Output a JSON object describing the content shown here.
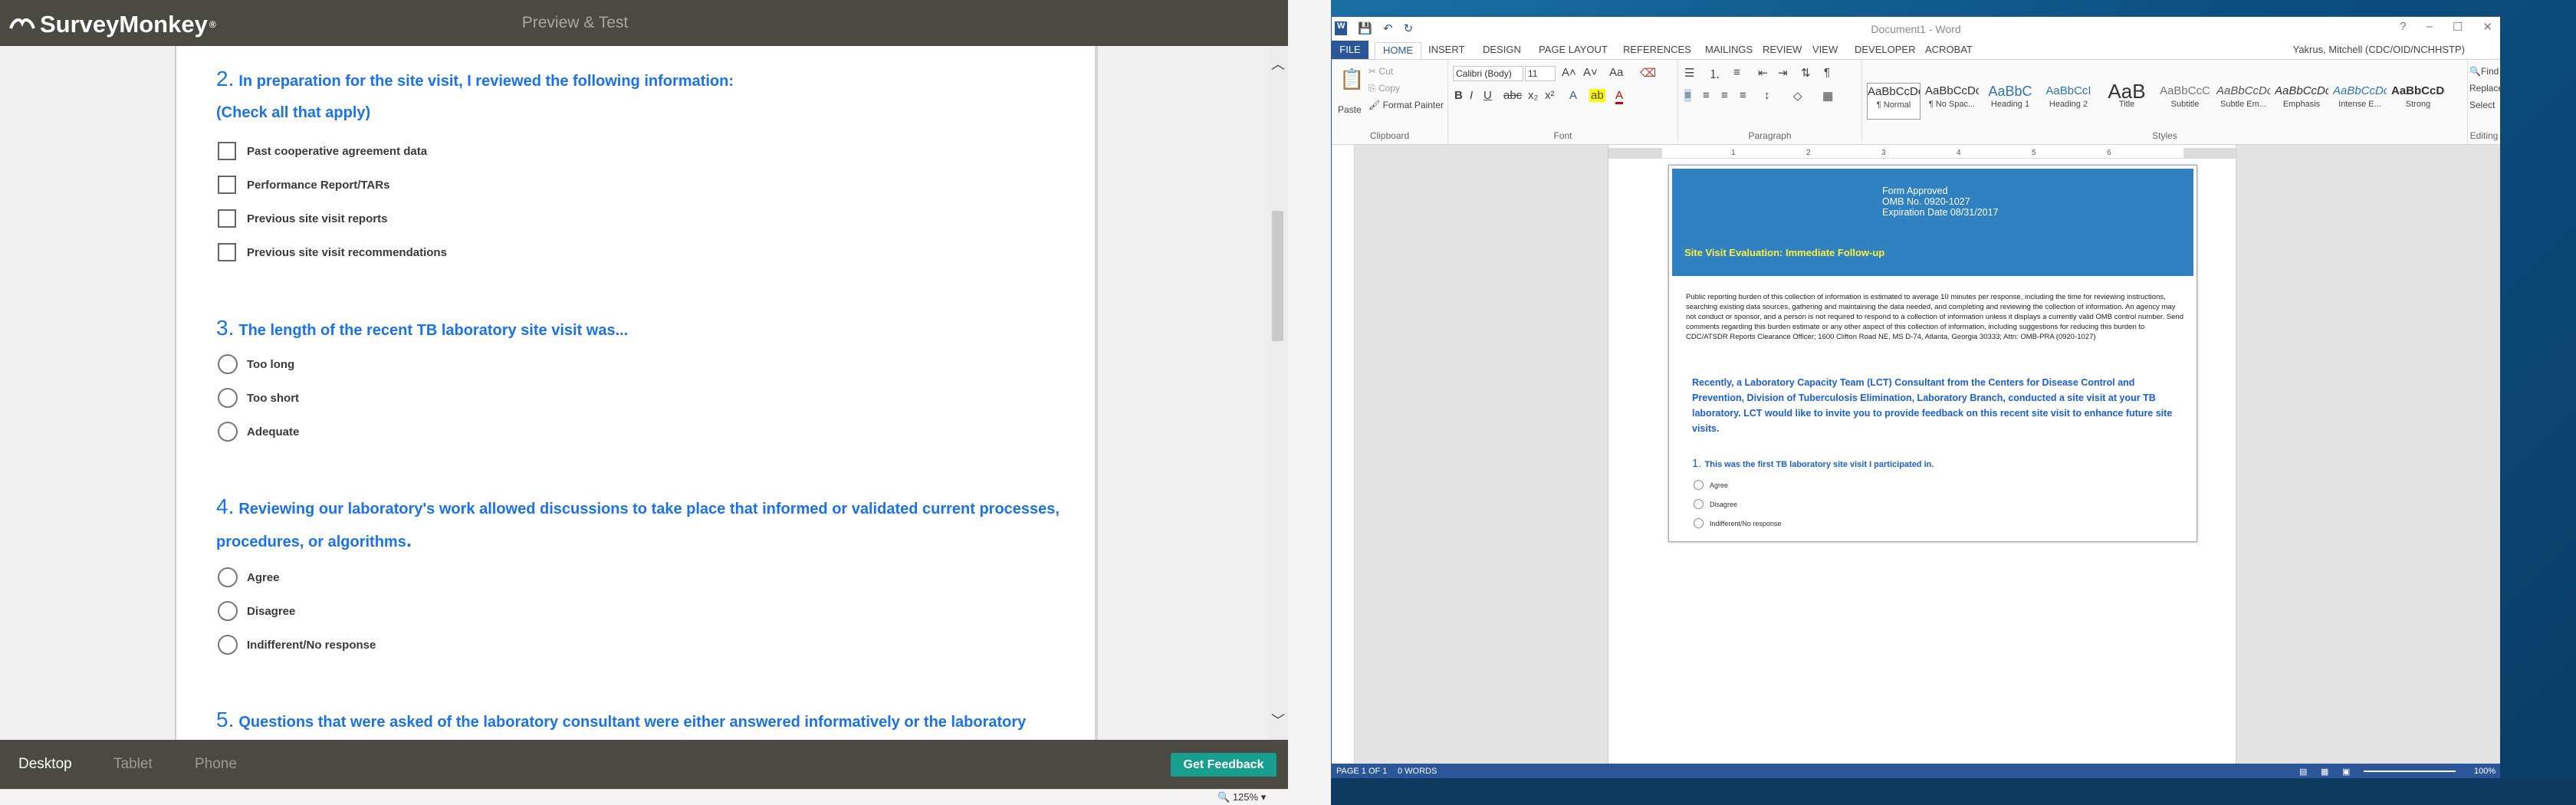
{
  "surveymonkey": {
    "logo": "SurveyMonkey",
    "logo_mark": "®",
    "title": "Preview & Test",
    "questions": [
      {
        "num": "2.",
        "text": "In preparation for the site visit, I reviewed the following information:",
        "sub": "(Check all that apply)",
        "options": [
          "Past cooperative agreement data",
          "Performance Report/TARs",
          "Previous site visit reports",
          "Previous site visit recommendations"
        ]
      },
      {
        "num": "3.",
        "text": "The length of the recent TB laboratory site visit was...",
        "options": [
          "Too long",
          "Too short",
          "Adequate"
        ]
      },
      {
        "num": "4.",
        "text": "Reviewing our laboratory's work allowed discussions to take place that informed or validated current processes,",
        "text2": "procedures, or algorithms",
        "options": [
          "Agree",
          "Disagree",
          "Indifferent/No response"
        ]
      },
      {
        "num": "5.",
        "text": "Questions that were asked of the laboratory consultant were either answered informatively or the laboratory"
      }
    ],
    "devices": {
      "desktop": "Desktop",
      "tablet": "Tablet",
      "phone": "Phone"
    },
    "feedback_button": "Get Feedback",
    "zoom": "125%"
  },
  "word": {
    "doc_title": "Document1 - Word",
    "tabs": {
      "file": "FILE",
      "home": "HOME",
      "insert": "INSERT",
      "design": "DESIGN",
      "layout": "PAGE LAYOUT",
      "references": "REFERENCES",
      "mailings": "MAILINGS",
      "review": "REVIEW",
      "view": "VIEW",
      "developer": "DEVELOPER",
      "acrobat": "ACROBAT"
    },
    "user": "Yakrus, Mitchell (CDC/OID/NCHHSTP)",
    "clipboard": {
      "paste": "Paste",
      "cut": "Cut",
      "copy": "Copy",
      "format_painter": "Format Painter",
      "label": "Clipboard"
    },
    "font": {
      "name": "Calibri (Body)",
      "size": "11",
      "label": "Font"
    },
    "paragraph_label": "Paragraph",
    "styles": [
      {
        "preview": "AaBbCcDc",
        "name": "¶ Normal"
      },
      {
        "preview": "AaBbCcDc",
        "name": "¶ No Spac..."
      },
      {
        "preview": "AaBbC",
        "name": "Heading 1"
      },
      {
        "preview": "AaBbCcI",
        "name": "Heading 2"
      },
      {
        "preview": "AaB",
        "name": "Title"
      },
      {
        "preview": "AaBbCcC",
        "name": "Subtitle"
      },
      {
        "preview": "AaBbCcDc",
        "name": "Subtle Em..."
      },
      {
        "preview": "AaBbCcDc",
        "name": "Emphasis"
      },
      {
        "preview": "AaBbCcDc",
        "name": "Intense E..."
      },
      {
        "preview": "AaBbCcDc",
        "name": "Strong"
      }
    ],
    "styles_label": "Styles",
    "editing": {
      "find": "Find",
      "replace": "Replace",
      "select": "Select",
      "label": "Editing"
    },
    "ruler_numbers": [
      "1",
      "2",
      "3",
      "4",
      "5",
      "6"
    ],
    "form": {
      "omb1": "Form Approved",
      "omb2": "OMB No. 0920-1027",
      "omb3": "Expiration Date 08/31/2017",
      "site_title": "Site Visit Evaluation: Immediate Follow-up",
      "burden": "Public reporting burden of this collection of information is estimated to average 10 minutes per response, including the time for reviewing instructions, searching existing data sources, gathering and maintaining the data needed, and completing and reviewing the collection of information.  An agency may not conduct or sponsor, and a person is not required to respond to a collection of information unless it displays a currently valid OMB control number.  Send comments regarding this burden estimate or any other aspect of this collection of information, including suggestions for reducing this burden to CDC/ATSDR Reports Clearance Officer; 1600 Clifton Road NE, MS D-74, Atlanta, Georgia 30333; Attn: OMB-PRA (0920-1027)",
      "intro": "Recently, a Laboratory Capacity Team (LCT) Consultant from the Centers for Disease Control and Prevention, Division of Tuberculosis Elimination, Laboratory Branch, conducted a site visit at your TB laboratory. LCT would like to invite you to provide feedback on this recent site visit to enhance future site visits.",
      "q1_num": "1.",
      "q1": "This was the first TB laboratory site visit I participated in.",
      "q1_options": [
        "Agree",
        "Disagree",
        "Indifferent/No response"
      ]
    },
    "status": {
      "page": "PAGE 1 OF 1",
      "words": "0 WORDS",
      "zoom": "100%"
    }
  }
}
